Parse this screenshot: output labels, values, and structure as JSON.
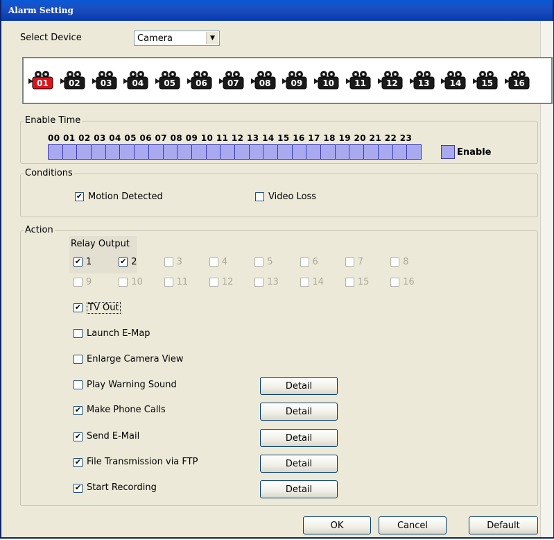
{
  "window": {
    "title": "Alarm Setting"
  },
  "select_device": {
    "label": "Select Device",
    "value": "Camera"
  },
  "cameras": [
    "01",
    "02",
    "03",
    "04",
    "05",
    "06",
    "07",
    "08",
    "09",
    "10",
    "11",
    "12",
    "13",
    "14",
    "15",
    "16"
  ],
  "selected_camera": "01",
  "enable_time": {
    "legend": "Enable Time",
    "hours_text": "00 01 02 03 04 05 06 07 08 09 10 11 12 13 14 15 16 17 18 19 20 21 22 23",
    "enable_label": "Enable"
  },
  "conditions": {
    "legend": "Conditions",
    "motion_detected": {
      "label": "Motion Detected",
      "checked": true
    },
    "video_loss": {
      "label": "Video Loss",
      "checked": false
    }
  },
  "action": {
    "legend": "Action",
    "relay_output_label": "Relay Output",
    "relays": [
      {
        "label": "1",
        "checked": true,
        "enabled": true
      },
      {
        "label": "2",
        "checked": true,
        "enabled": true
      },
      {
        "label": "3",
        "checked": false,
        "enabled": false
      },
      {
        "label": "4",
        "checked": false,
        "enabled": false
      },
      {
        "label": "5",
        "checked": false,
        "enabled": false
      },
      {
        "label": "6",
        "checked": false,
        "enabled": false
      },
      {
        "label": "7",
        "checked": false,
        "enabled": false
      },
      {
        "label": "8",
        "checked": false,
        "enabled": false
      },
      {
        "label": "9",
        "checked": false,
        "enabled": false
      },
      {
        "label": "10",
        "checked": false,
        "enabled": false
      },
      {
        "label": "11",
        "checked": false,
        "enabled": false
      },
      {
        "label": "12",
        "checked": false,
        "enabled": false
      },
      {
        "label": "13",
        "checked": false,
        "enabled": false
      },
      {
        "label": "14",
        "checked": false,
        "enabled": false
      },
      {
        "label": "15",
        "checked": false,
        "enabled": false
      },
      {
        "label": "16",
        "checked": false,
        "enabled": false
      }
    ],
    "tv_out": {
      "label": "TV Out",
      "checked": true
    },
    "launch_emap": {
      "label": "Launch E-Map",
      "checked": false
    },
    "enlarge_camera_view": {
      "label": "Enlarge Camera View",
      "checked": false
    },
    "play_warning_sound": {
      "label": "Play Warning Sound",
      "checked": false
    },
    "make_phone_calls": {
      "label": "Make Phone Calls",
      "checked": true
    },
    "send_email": {
      "label": "Send E-Mail",
      "checked": true
    },
    "ftp": {
      "label": "File Transmission via FTP",
      "checked": true
    },
    "start_recording": {
      "label": "Start Recording",
      "checked": true
    },
    "detail_label": "Detail"
  },
  "buttons": {
    "ok": "OK",
    "cancel": "Cancel",
    "default": "Default"
  },
  "colors": {
    "title_blue": "#0a4fc6",
    "hour_fill": "#a9a9ef",
    "selected_camera_red": "#e0121a"
  }
}
